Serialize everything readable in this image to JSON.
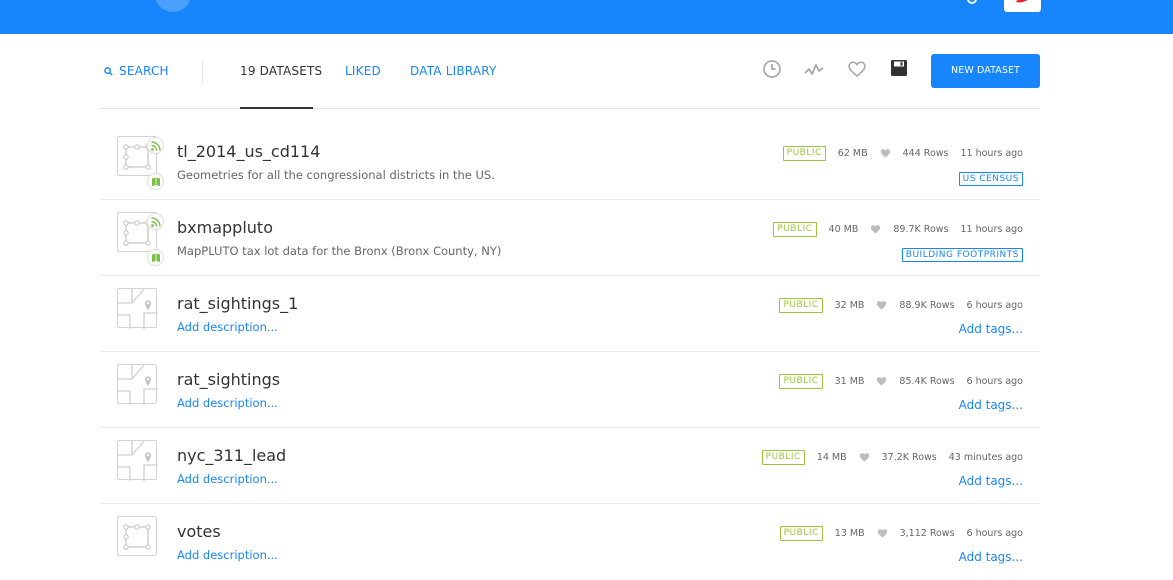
{
  "nav": {
    "search": "SEARCH",
    "datasets": "19 DATASETS",
    "liked": "LIKED",
    "library": "DATA LIBRARY",
    "new_button": "NEW DATASET"
  },
  "datasets": [
    {
      "name": "tl_2014_us_cd114",
      "description": "Geometries for all the congressional districts in the US.",
      "privacy": "PUBLIC",
      "size": "62 MB",
      "rows": "444 Rows",
      "updated": "11 hours ago",
      "tag": "US CENSUS",
      "icon": "polygon"
    },
    {
      "name": "bxmappluto",
      "description": "MapPLUTO tax lot data for the Bronx (Bronx County, NY)",
      "privacy": "PUBLIC",
      "size": "40 MB",
      "rows": "89.7K Rows",
      "updated": "11 hours ago",
      "tag": "BUILDING FOOTPRINTS",
      "icon": "polygon"
    },
    {
      "name": "rat_sightings_1",
      "description": "Add description...",
      "privacy": "PUBLIC",
      "size": "32 MB",
      "rows": "88.9K Rows",
      "updated": "6 hours ago",
      "tag": "Add tags...",
      "icon": "point"
    },
    {
      "name": "rat_sightings",
      "description": "Add description...",
      "privacy": "PUBLIC",
      "size": "31 MB",
      "rows": "85.4K Rows",
      "updated": "6 hours ago",
      "tag": "Add tags...",
      "icon": "point"
    },
    {
      "name": "nyc_311_lead",
      "description": "Add description...",
      "privacy": "PUBLIC",
      "size": "14 MB",
      "rows": "37.2K Rows",
      "updated": "43 minutes ago",
      "tag": "Add tags...",
      "icon": "point"
    },
    {
      "name": "votes",
      "description": "Add description...",
      "privacy": "PUBLIC",
      "size": "13 MB",
      "rows": "3,112 Rows",
      "updated": "6 hours ago",
      "tag": "Add tags...",
      "icon": "polygon"
    }
  ],
  "colors": {
    "brand": "#1785fb",
    "public": "#9bc63b",
    "sync": "#7ac143"
  },
  "icons": [
    "search-icon",
    "clock-icon",
    "activity-icon",
    "heart-icon",
    "save-icon",
    "rss-icon",
    "book-icon",
    "polygon-icon",
    "map-pin-icon"
  ]
}
